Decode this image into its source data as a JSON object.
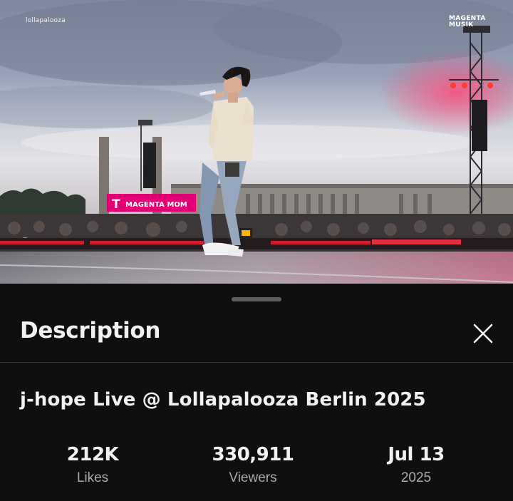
{
  "video": {
    "watermark_left": "lollapalooza",
    "watermark_right": [
      "MAGENTA",
      "MUSIK"
    ],
    "stage_banner": "MAGENTA MOM"
  },
  "sheet": {
    "title": "Description",
    "close_icon": "close-icon"
  },
  "description": {
    "video_title": "j-hope Live @ Lollapalooza Berlin 2025",
    "stats": [
      {
        "value": "212K",
        "label": "Likes"
      },
      {
        "value": "330,911",
        "label": "Viewers"
      },
      {
        "value": "Jul 13",
        "label": "2025"
      }
    ]
  },
  "colors": {
    "background": "#0f0f0f",
    "text_primary": "#f1f1f1",
    "text_secondary": "#aaaaaa",
    "divider": "#3b3b3b",
    "magenta": "#e20074"
  }
}
